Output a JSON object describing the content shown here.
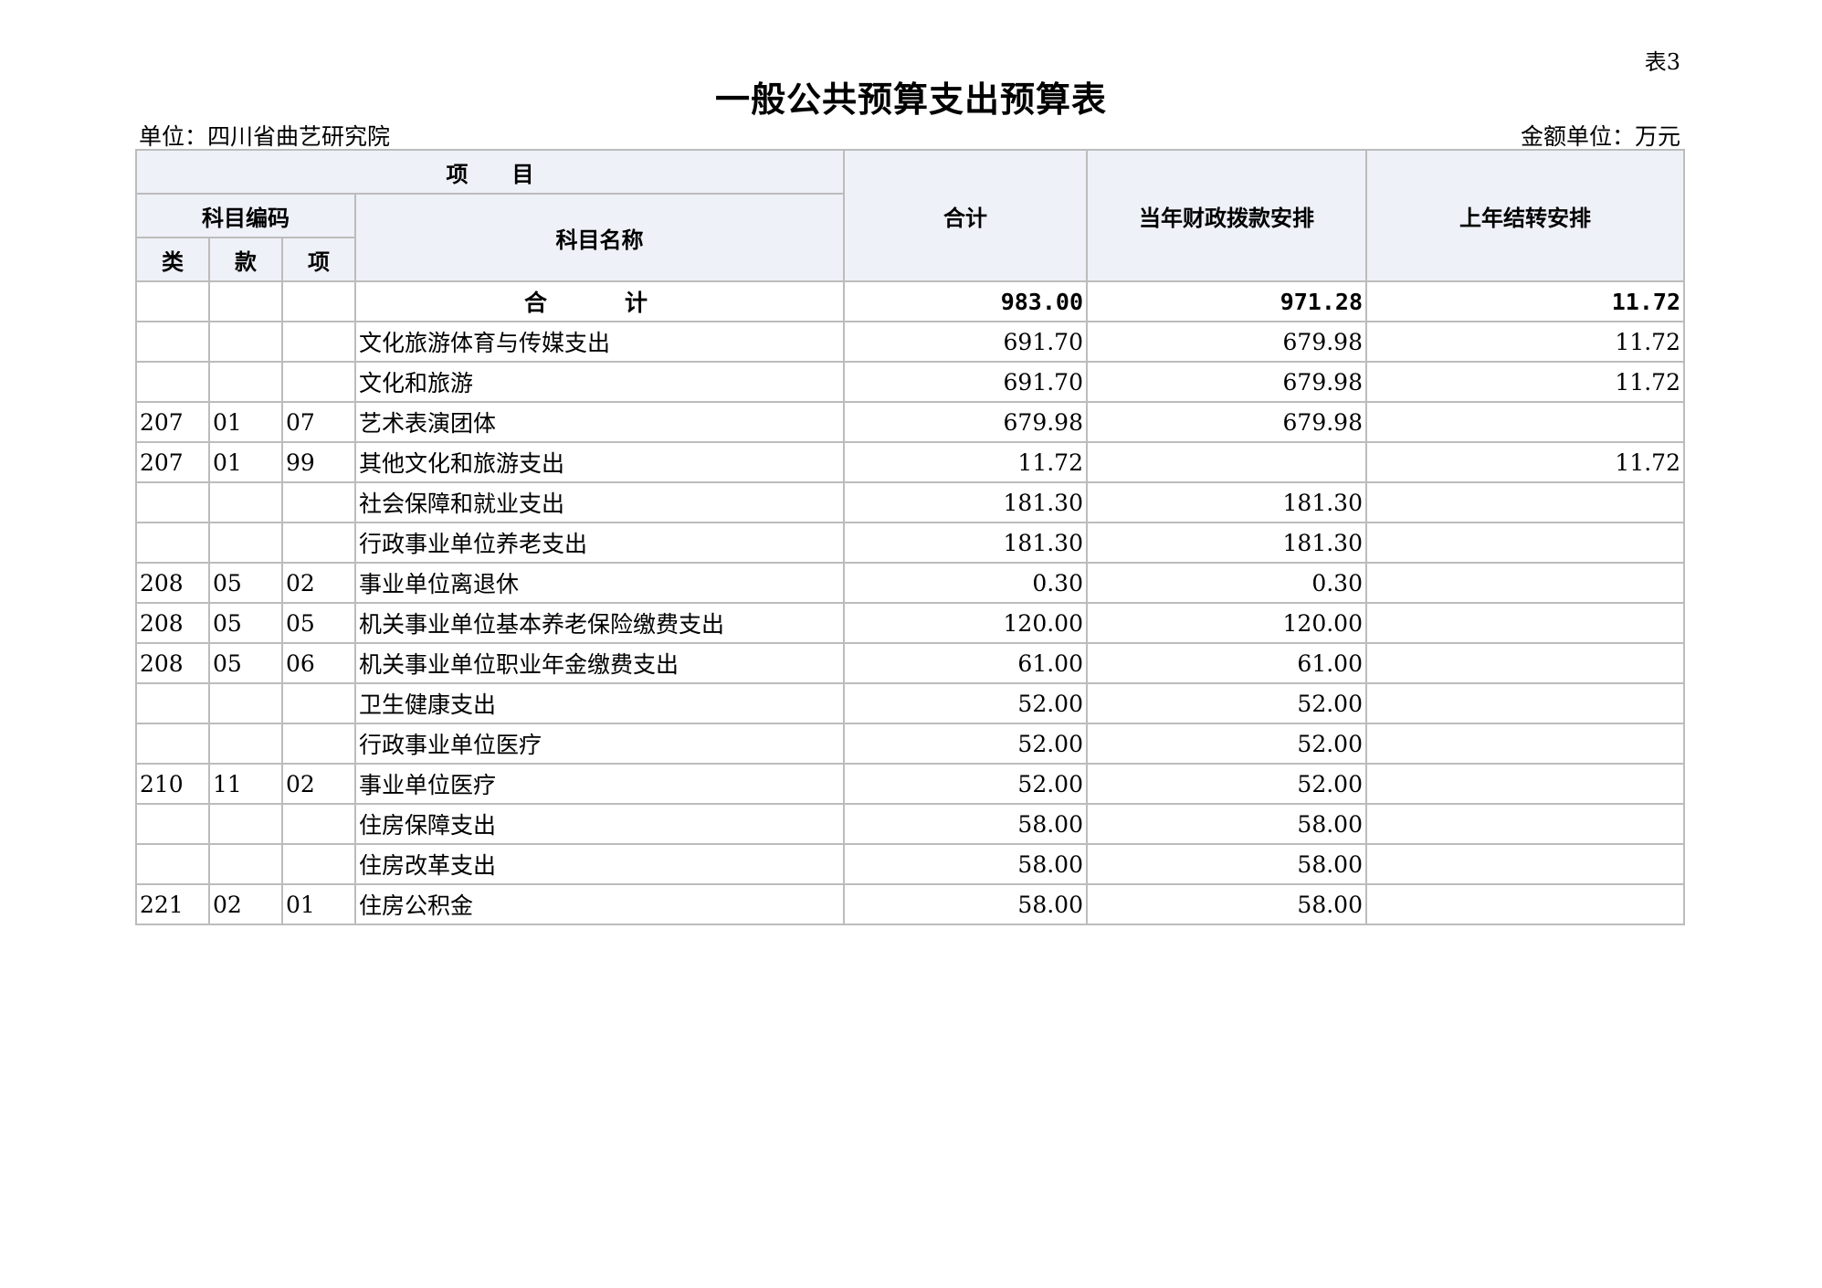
{
  "table_no": "表3",
  "title": "一般公共预算支出预算表",
  "unit_label": "单位：四川省曲艺研究院",
  "amount_unit_label": "金额单位：万元",
  "headers": {
    "project": "项　　目",
    "code": "科目编码",
    "class": "类",
    "section": "款",
    "item": "项",
    "name": "科目名称",
    "total": "合计",
    "current_year": "当年财政拨款安排",
    "last_year": "上年结转安排"
  },
  "total_row": {
    "label": "合　计",
    "total": "983.00",
    "current": "971.28",
    "last": "11.72"
  },
  "rows": [
    {
      "c1": "",
      "c2": "",
      "c3": "",
      "level": 1,
      "name": "文化旅游体育与传媒支出",
      "total": "691.70",
      "current": "679.98",
      "last": "11.72"
    },
    {
      "c1": "",
      "c2": "",
      "c3": "",
      "level": 2,
      "name": "文化和旅游",
      "total": "691.70",
      "current": "679.98",
      "last": "11.72"
    },
    {
      "c1": "207",
      "c2": "01",
      "c3": "07",
      "level": 3,
      "name": "艺术表演团体",
      "total": "679.98",
      "current": "679.98",
      "last": ""
    },
    {
      "c1": "207",
      "c2": "01",
      "c3": "99",
      "level": 3,
      "name": "其他文化和旅游支出",
      "total": "11.72",
      "current": "",
      "last": "11.72"
    },
    {
      "c1": "",
      "c2": "",
      "c3": "",
      "level": 1,
      "name": "社会保障和就业支出",
      "total": "181.30",
      "current": "181.30",
      "last": ""
    },
    {
      "c1": "",
      "c2": "",
      "c3": "",
      "level": 2,
      "name": "行政事业单位养老支出",
      "total": "181.30",
      "current": "181.30",
      "last": ""
    },
    {
      "c1": "208",
      "c2": "05",
      "c3": "02",
      "level": 3,
      "name": "事业单位离退休",
      "total": "0.30",
      "current": "0.30",
      "last": ""
    },
    {
      "c1": "208",
      "c2": "05",
      "c3": "05",
      "level": 3,
      "name": "机关事业单位基本养老保险缴费支出",
      "total": "120.00",
      "current": "120.00",
      "last": ""
    },
    {
      "c1": "208",
      "c2": "05",
      "c3": "06",
      "level": 3,
      "name": "机关事业单位职业年金缴费支出",
      "total": "61.00",
      "current": "61.00",
      "last": ""
    },
    {
      "c1": "",
      "c2": "",
      "c3": "",
      "level": 1,
      "name": "卫生健康支出",
      "total": "52.00",
      "current": "52.00",
      "last": ""
    },
    {
      "c1": "",
      "c2": "",
      "c3": "",
      "level": 2,
      "name": "行政事业单位医疗",
      "total": "52.00",
      "current": "52.00",
      "last": ""
    },
    {
      "c1": "210",
      "c2": "11",
      "c3": "02",
      "level": 3,
      "name": "事业单位医疗",
      "total": "52.00",
      "current": "52.00",
      "last": ""
    },
    {
      "c1": "",
      "c2": "",
      "c3": "",
      "level": 1,
      "name": "住房保障支出",
      "total": "58.00",
      "current": "58.00",
      "last": ""
    },
    {
      "c1": "",
      "c2": "",
      "c3": "",
      "level": 2,
      "name": "住房改革支出",
      "total": "58.00",
      "current": "58.00",
      "last": ""
    },
    {
      "c1": "221",
      "c2": "02",
      "c3": "01",
      "level": 3,
      "name": "住房公积金",
      "total": "58.00",
      "current": "58.00",
      "last": ""
    }
  ]
}
